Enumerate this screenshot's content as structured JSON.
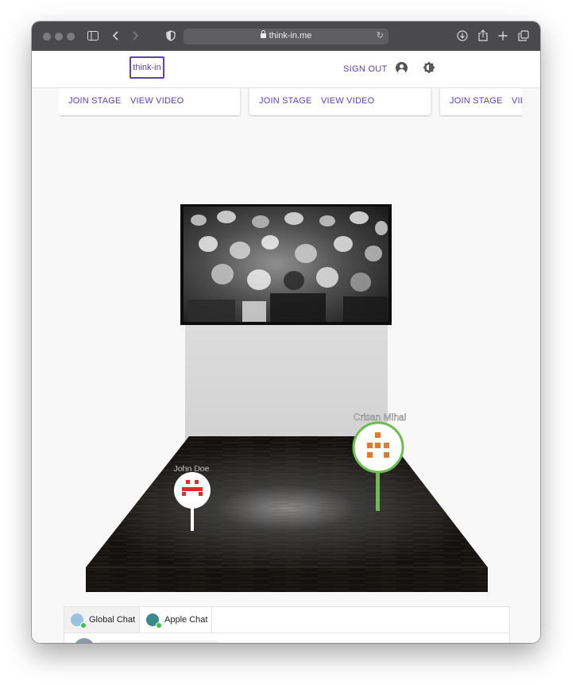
{
  "browser": {
    "url": "think-in.me"
  },
  "header": {
    "logo": "think-in",
    "signout_label": "SIGN OUT"
  },
  "stages": [
    {
      "join_label": "JOIN STAGE",
      "video_label": "VIEW VIDEO"
    },
    {
      "join_label": "JOIN STAGE",
      "video_label": "VIEW VIDEO"
    },
    {
      "join_label": "JOIN STAGE",
      "video_label": "VIEW VIDEO"
    }
  ],
  "scene": {
    "avatars": [
      {
        "name": "John Doe",
        "color": "#e02b2b",
        "ring": "#ffffff"
      },
      {
        "name": "Crisan Mihai",
        "color": "#e07a2e",
        "ring": "#6abf4b"
      }
    ]
  },
  "chat": {
    "tabs": [
      {
        "label": "Global Chat",
        "avatar_color": "#9ac4de",
        "active": true
      },
      {
        "label": "Apple Chat",
        "avatar_color": "#3a8a8c",
        "active": false
      }
    ]
  },
  "colors": {
    "accent": "#5b3fbf",
    "online": "#3ac14a"
  }
}
